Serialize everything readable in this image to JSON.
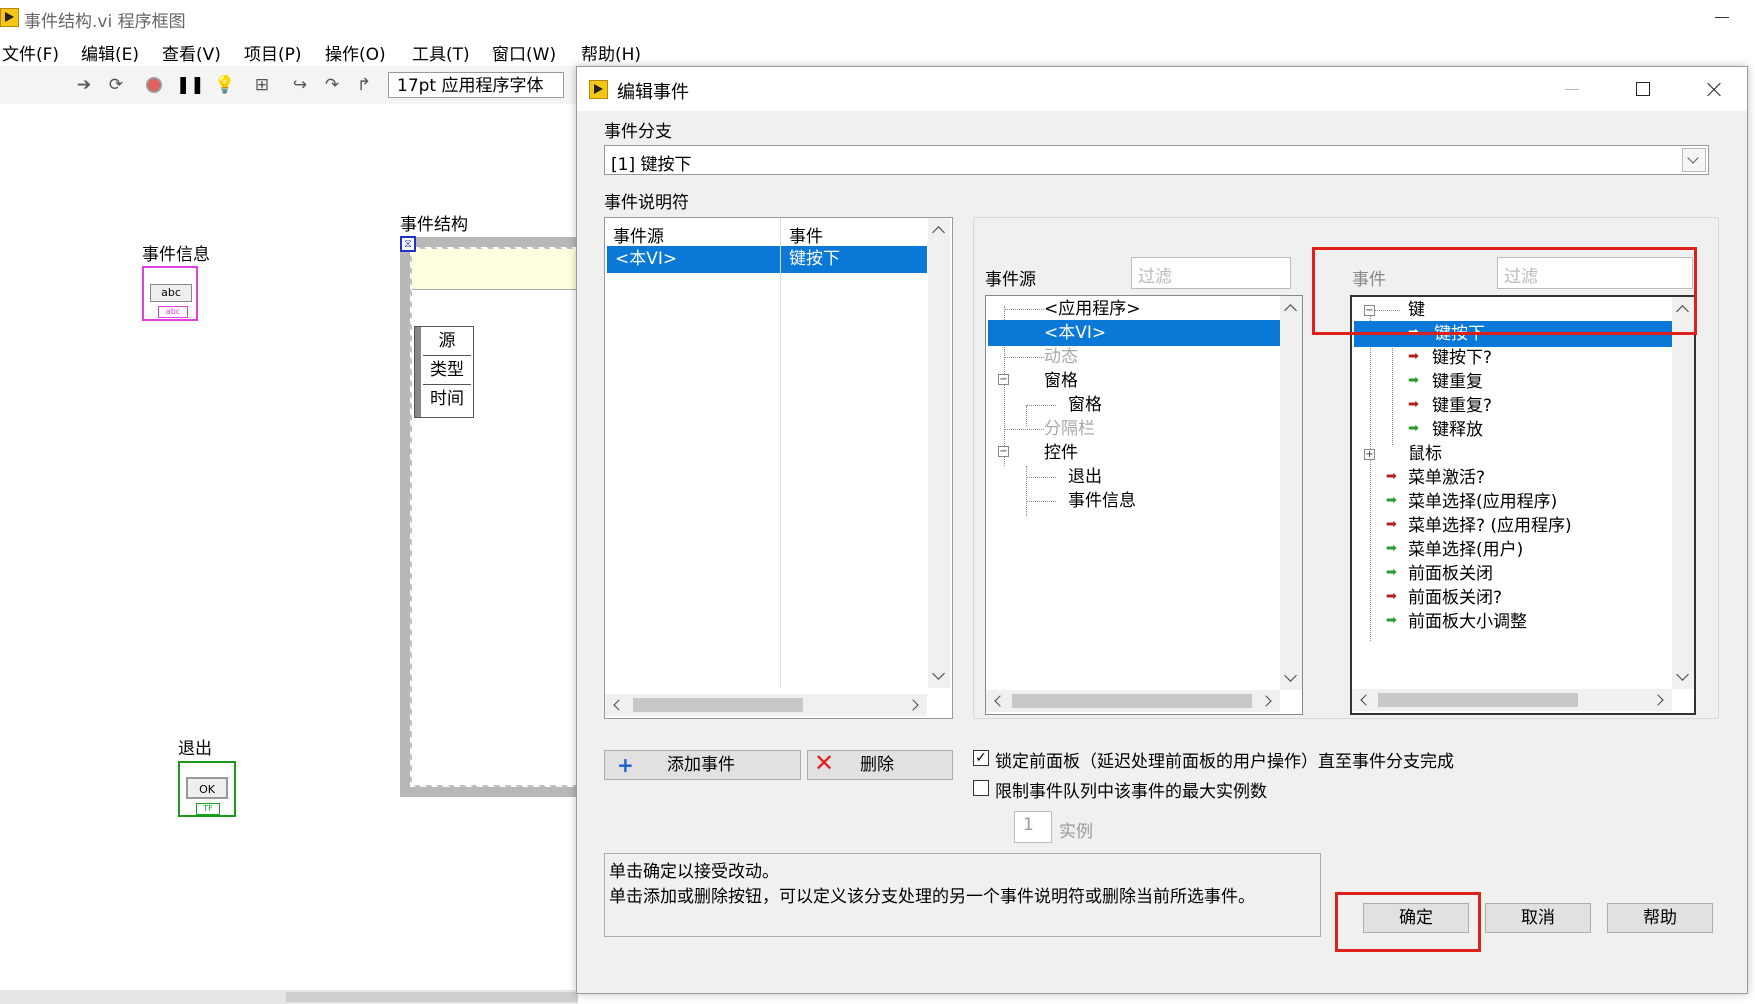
{
  "main_window": {
    "title": "事件结构.vi 程序框图",
    "menu": [
      "文件(F)",
      "编辑(E)",
      "查看(V)",
      "项目(P)",
      "操作(O)",
      "工具(T)",
      "窗口(W)",
      "帮助(H)"
    ],
    "font_select": "17pt 应用程序字体"
  },
  "diagram": {
    "event_info_label": "事件信息",
    "event_info_term_text": "abc",
    "event_info_term_sub": "abc",
    "event_struct_label": "事件结构",
    "node_rows": [
      "源",
      "类型",
      "时间"
    ],
    "quit_label": "退出",
    "quit_button_text": "OK",
    "quit_term_sub": "TF"
  },
  "dialog": {
    "title": "编辑事件",
    "case_label": "事件分支",
    "case_value": "[1] 键按下",
    "specifiers_label": "事件说明符",
    "table": {
      "headers": [
        "事件源",
        "事件"
      ],
      "rows": [
        {
          "source": "<本VI>",
          "event": "键按下"
        }
      ]
    },
    "sources_label": "事件源",
    "sources_filter_placeholder": "过滤",
    "sources_tree": [
      {
        "label": "<应用程序>",
        "state": "normal"
      },
      {
        "label": "<本VI>",
        "state": "selected"
      },
      {
        "label": "动态",
        "state": "disabled"
      },
      {
        "label": "窗格",
        "state": "normal"
      },
      {
        "label": "窗格",
        "state": "normal"
      },
      {
        "label": "分隔栏",
        "state": "disabled"
      },
      {
        "label": "控件",
        "state": "normal"
      },
      {
        "label": "退出",
        "state": "normal"
      },
      {
        "label": "事件信息",
        "state": "normal"
      }
    ],
    "events_label": "事件",
    "events_filter_placeholder": "过滤",
    "events_tree": [
      {
        "label": "键",
        "arrow": "none"
      },
      {
        "label": "键按下",
        "arrow": "green"
      },
      {
        "label": "键按下?",
        "arrow": "red"
      },
      {
        "label": "键重复",
        "arrow": "green"
      },
      {
        "label": "键重复?",
        "arrow": "red"
      },
      {
        "label": "键释放",
        "arrow": "green"
      },
      {
        "label": "鼠标",
        "arrow": "none"
      },
      {
        "label": "菜单激活?",
        "arrow": "red"
      },
      {
        "label": "菜单选择(应用程序)",
        "arrow": "green"
      },
      {
        "label": "菜单选择? (应用程序)",
        "arrow": "red"
      },
      {
        "label": "菜单选择(用户)",
        "arrow": "green"
      },
      {
        "label": "前面板关闭",
        "arrow": "green"
      },
      {
        "label": "前面板关闭?",
        "arrow": "red"
      },
      {
        "label": "前面板大小调整",
        "arrow": "green"
      }
    ],
    "add_event_label": "添加事件",
    "delete_label": "删除",
    "lock_panel_label": "锁定前面板（延迟处理前面板的用户操作）直至事件分支完成",
    "lock_panel_checked": true,
    "limit_instances_label": "限制事件队列中该事件的最大实例数",
    "limit_instances_checked": false,
    "instances_value": "1",
    "instances_unit": "实例",
    "help_line1": "单击确定以接受改动。",
    "help_line2": "单击添加或删除按钮，可以定义该分支处理的另一个事件说明符或删除当前所选事件。",
    "ok_label": "确定",
    "cancel_label": "取消",
    "help_label": "帮助"
  },
  "colors": {
    "selection": "#0a78d7",
    "highlight_box": "#e0201c",
    "event_info_wire": "#e040e0",
    "boolean_wire": "#1a9c1a"
  }
}
